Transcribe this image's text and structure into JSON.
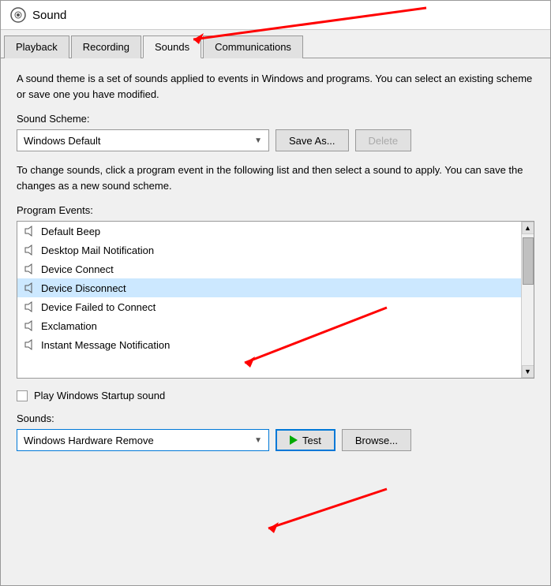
{
  "window": {
    "title": "Sound"
  },
  "tabs": [
    {
      "label": "Playback",
      "active": false
    },
    {
      "label": "Recording",
      "active": false
    },
    {
      "label": "Sounds",
      "active": true
    },
    {
      "label": "Communications",
      "active": false
    }
  ],
  "sounds_tab": {
    "description": "A sound theme is a set of sounds applied to events in Windows and programs.  You can select an existing scheme or save one you have modified.",
    "sound_scheme_label": "Sound Scheme:",
    "sound_scheme_value": "Windows Default",
    "save_as_label": "Save As...",
    "delete_label": "Delete",
    "description2": "To change sounds, click a program event in the following list and then select a sound to apply.  You can save the changes as a new sound scheme.",
    "program_events_label": "Program Events:",
    "events": [
      {
        "label": "Default Beep",
        "selected": false
      },
      {
        "label": "Desktop Mail Notification",
        "selected": false
      },
      {
        "label": "Device Connect",
        "selected": false
      },
      {
        "label": "Device Disconnect",
        "selected": true
      },
      {
        "label": "Device Failed to Connect",
        "selected": false
      },
      {
        "label": "Exclamation",
        "selected": false
      },
      {
        "label": "Instant Message Notification",
        "selected": false
      }
    ],
    "play_startup_label": "Play Windows Startup sound",
    "sounds_label": "Sounds:",
    "sounds_value": "Windows Hardware Remove",
    "test_label": "Test",
    "browse_label": "Browse..."
  }
}
